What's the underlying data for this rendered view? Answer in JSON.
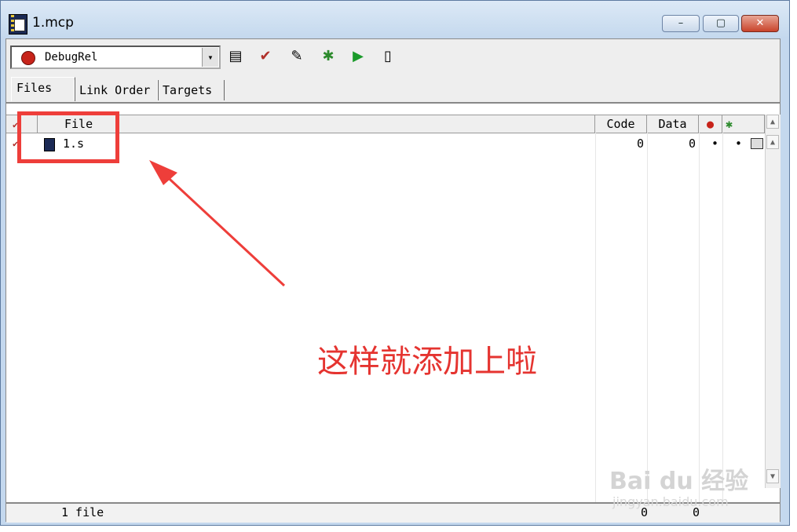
{
  "window": {
    "title": "1.mcp",
    "buttons": {
      "minimize": "–",
      "maximize": "▢",
      "close": "✕"
    }
  },
  "toolbar": {
    "target": "DebugRel",
    "dropdown_glyph": "▾",
    "icons": [
      "target-settings-icon",
      "make-icon",
      "bring-up-to-date-icon",
      "debug-icon",
      "run-icon",
      "disassemble-icon"
    ]
  },
  "tabs": [
    "Files",
    "Link Order",
    "Targets"
  ],
  "columns": {
    "file": "File",
    "code": "Code",
    "data": "Data"
  },
  "files": [
    {
      "name": "1.s",
      "code": "0",
      "data": "0",
      "debug": "•",
      "touched": "•"
    }
  ],
  "status": {
    "text": "1 file",
    "code_total": "0",
    "data_total": "0"
  },
  "annotation": {
    "text": "这样就添加上啦",
    "color": "#e53430"
  },
  "watermark": {
    "brand": "Bai du 经验",
    "sub": "jingyan.baidu.com"
  }
}
